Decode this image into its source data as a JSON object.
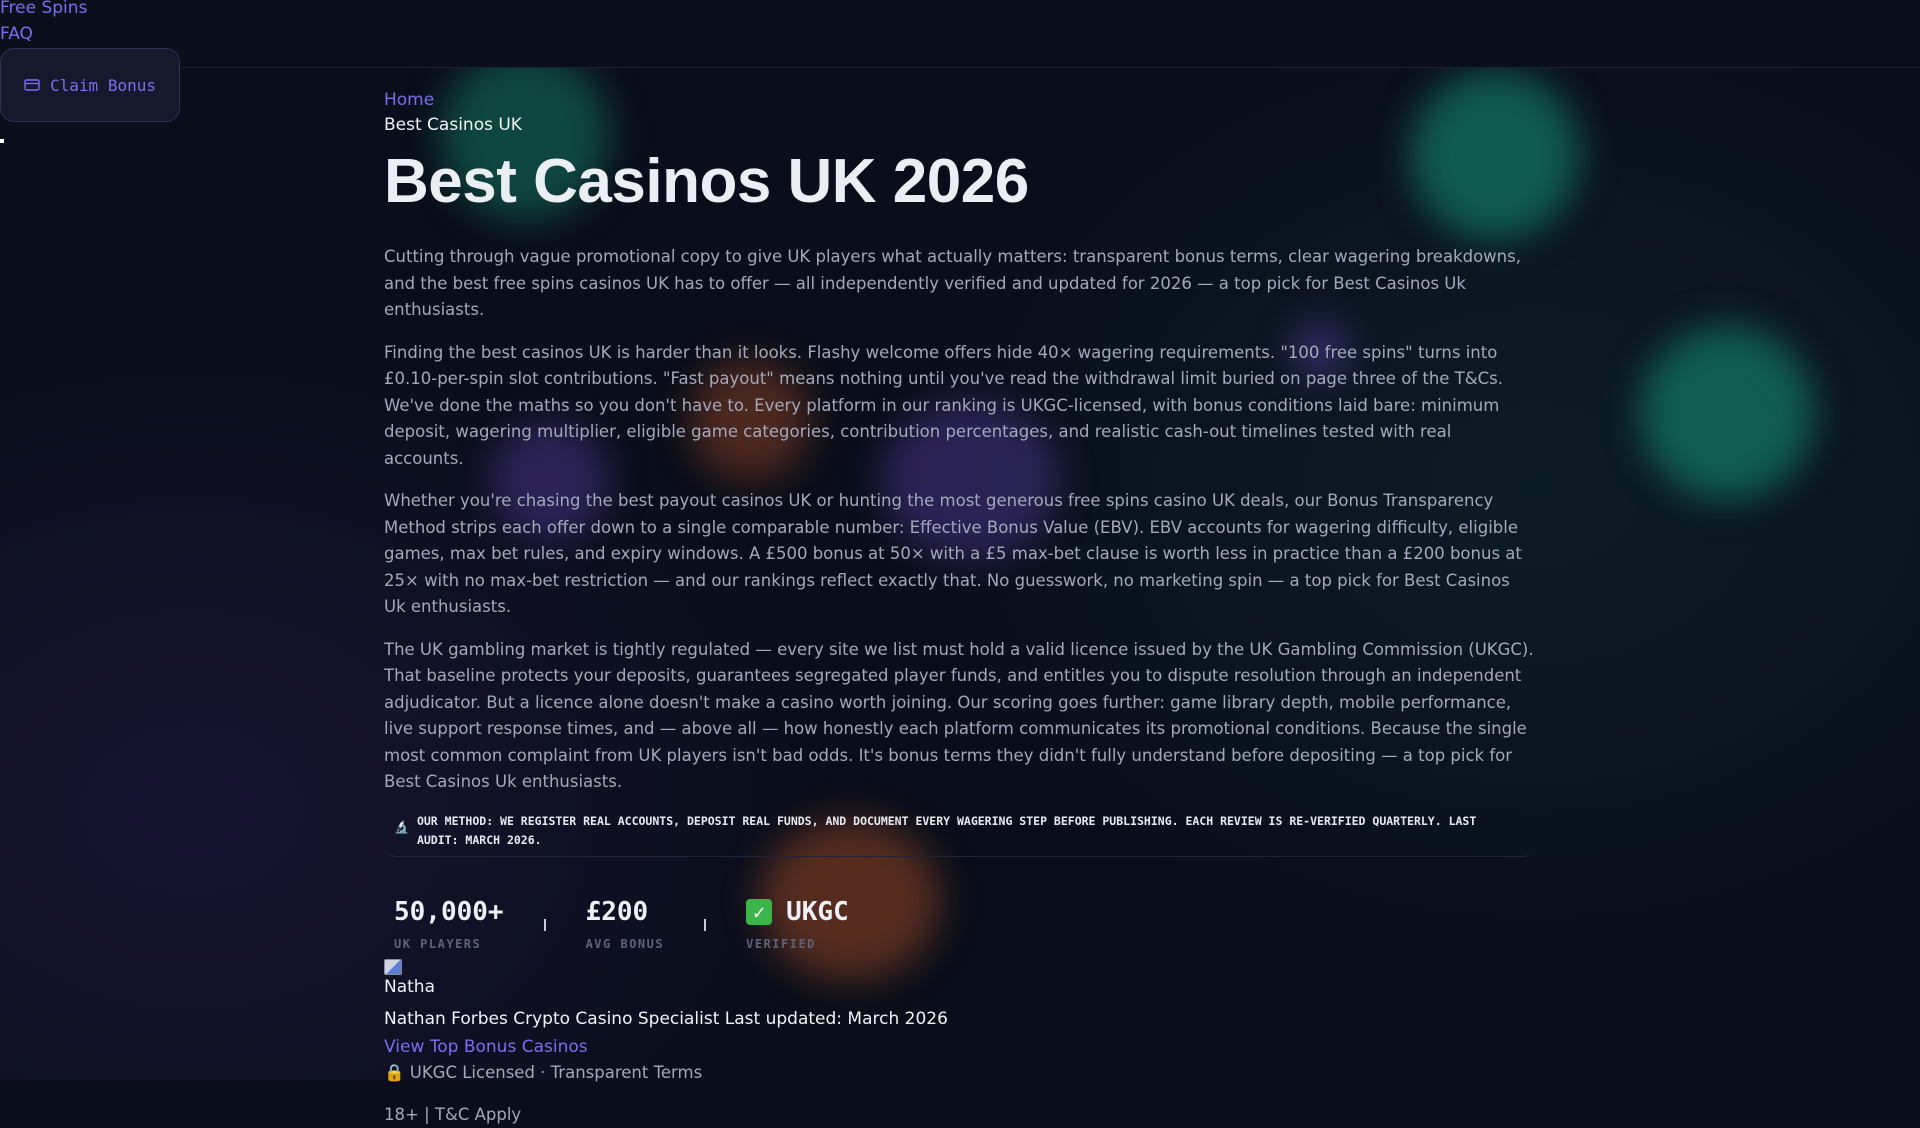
{
  "nav": {
    "free_spins": "Free Spins",
    "faq": "FAQ",
    "claim_bonus": "Claim Bonus"
  },
  "breadcrumb": {
    "home": "Home",
    "current": "Best Casinos UK"
  },
  "page": {
    "title": "Best Casinos UK 2026",
    "paragraphs": [
      "Cutting through vague promotional copy to give UK players what actually matters: transparent bonus terms, clear wagering breakdowns, and the best free spins casinos UK has to offer — all independently verified and updated for 2026 — a top pick for Best Casinos Uk enthusiasts.",
      "Finding the best casinos UK is harder than it looks. Flashy welcome offers hide 40× wagering requirements. \"100 free spins\" turns into £0.10-per-spin slot contributions. \"Fast payout\" means nothing until you've read the withdrawal limit buried on page three of the T&Cs. We've done the maths so you don't have to. Every platform in our ranking is UKGC-licensed, with bonus conditions laid bare: minimum deposit, wagering multiplier, eligible game categories, contribution percentages, and realistic cash-out timelines tested with real accounts.",
      "Whether you're chasing the best payout casinos UK or hunting the most generous free spins casino UK deals, our Bonus Transparency Method strips each offer down to a single comparable number: Effective Bonus Value (EBV). EBV accounts for wagering difficulty, eligible games, max bet rules, and expiry windows. A £500 bonus at 50× with a £5 max-bet clause is worth less in practice than a £200 bonus at 25× with no max-bet restriction — and our rankings reflect exactly that. No guesswork, no marketing spin — a top pick for Best Casinos Uk enthusiasts.",
      "The UK gambling market is tightly regulated — every site we list must hold a valid licence issued by the UK Gambling Commission (UKGC). That baseline protects your deposits, guarantees segregated player funds, and entitles you to dispute resolution through an independent adjudicator. But a licence alone doesn't make a casino worth joining. Our scoring goes further: game library depth, mobile performance, live support response times, and — above all — how honestly each platform communicates its promotional conditions. Because the single most common complaint from UK players isn't bad odds. It's bonus terms they didn't fully understand before depositing — a top pick for Best Casinos Uk enthusiasts."
    ],
    "method_icon": "🔬",
    "method_text": "Our method: we register real accounts, deposit real funds, and document every wagering step before publishing. Each review is re-verified quarterly. Last audit: March 2026."
  },
  "stats": [
    {
      "value": "50,000+",
      "label": "UK PLAYERS"
    },
    {
      "value": "£200",
      "label": "AVG BONUS"
    },
    {
      "value": "UKGC",
      "label": "VERIFIED",
      "icon": "check-mark-icon",
      "icon_glyph": "✓"
    }
  ],
  "author": {
    "short": "Natha",
    "line": "Nathan Forbes Crypto Casino Specialist Last updated: March 2026"
  },
  "cta": "View Top Bonus Casinos",
  "trust": "🔒 UKGC Licensed · Transparent Terms",
  "age_notice": "18+ | T&C Apply",
  "colors": {
    "background": "#0a0e1a",
    "accent": "#7b6cf0",
    "body_text": "#a3a8ba",
    "heading": "#eceef6",
    "verified_green": "#3bb54a"
  }
}
